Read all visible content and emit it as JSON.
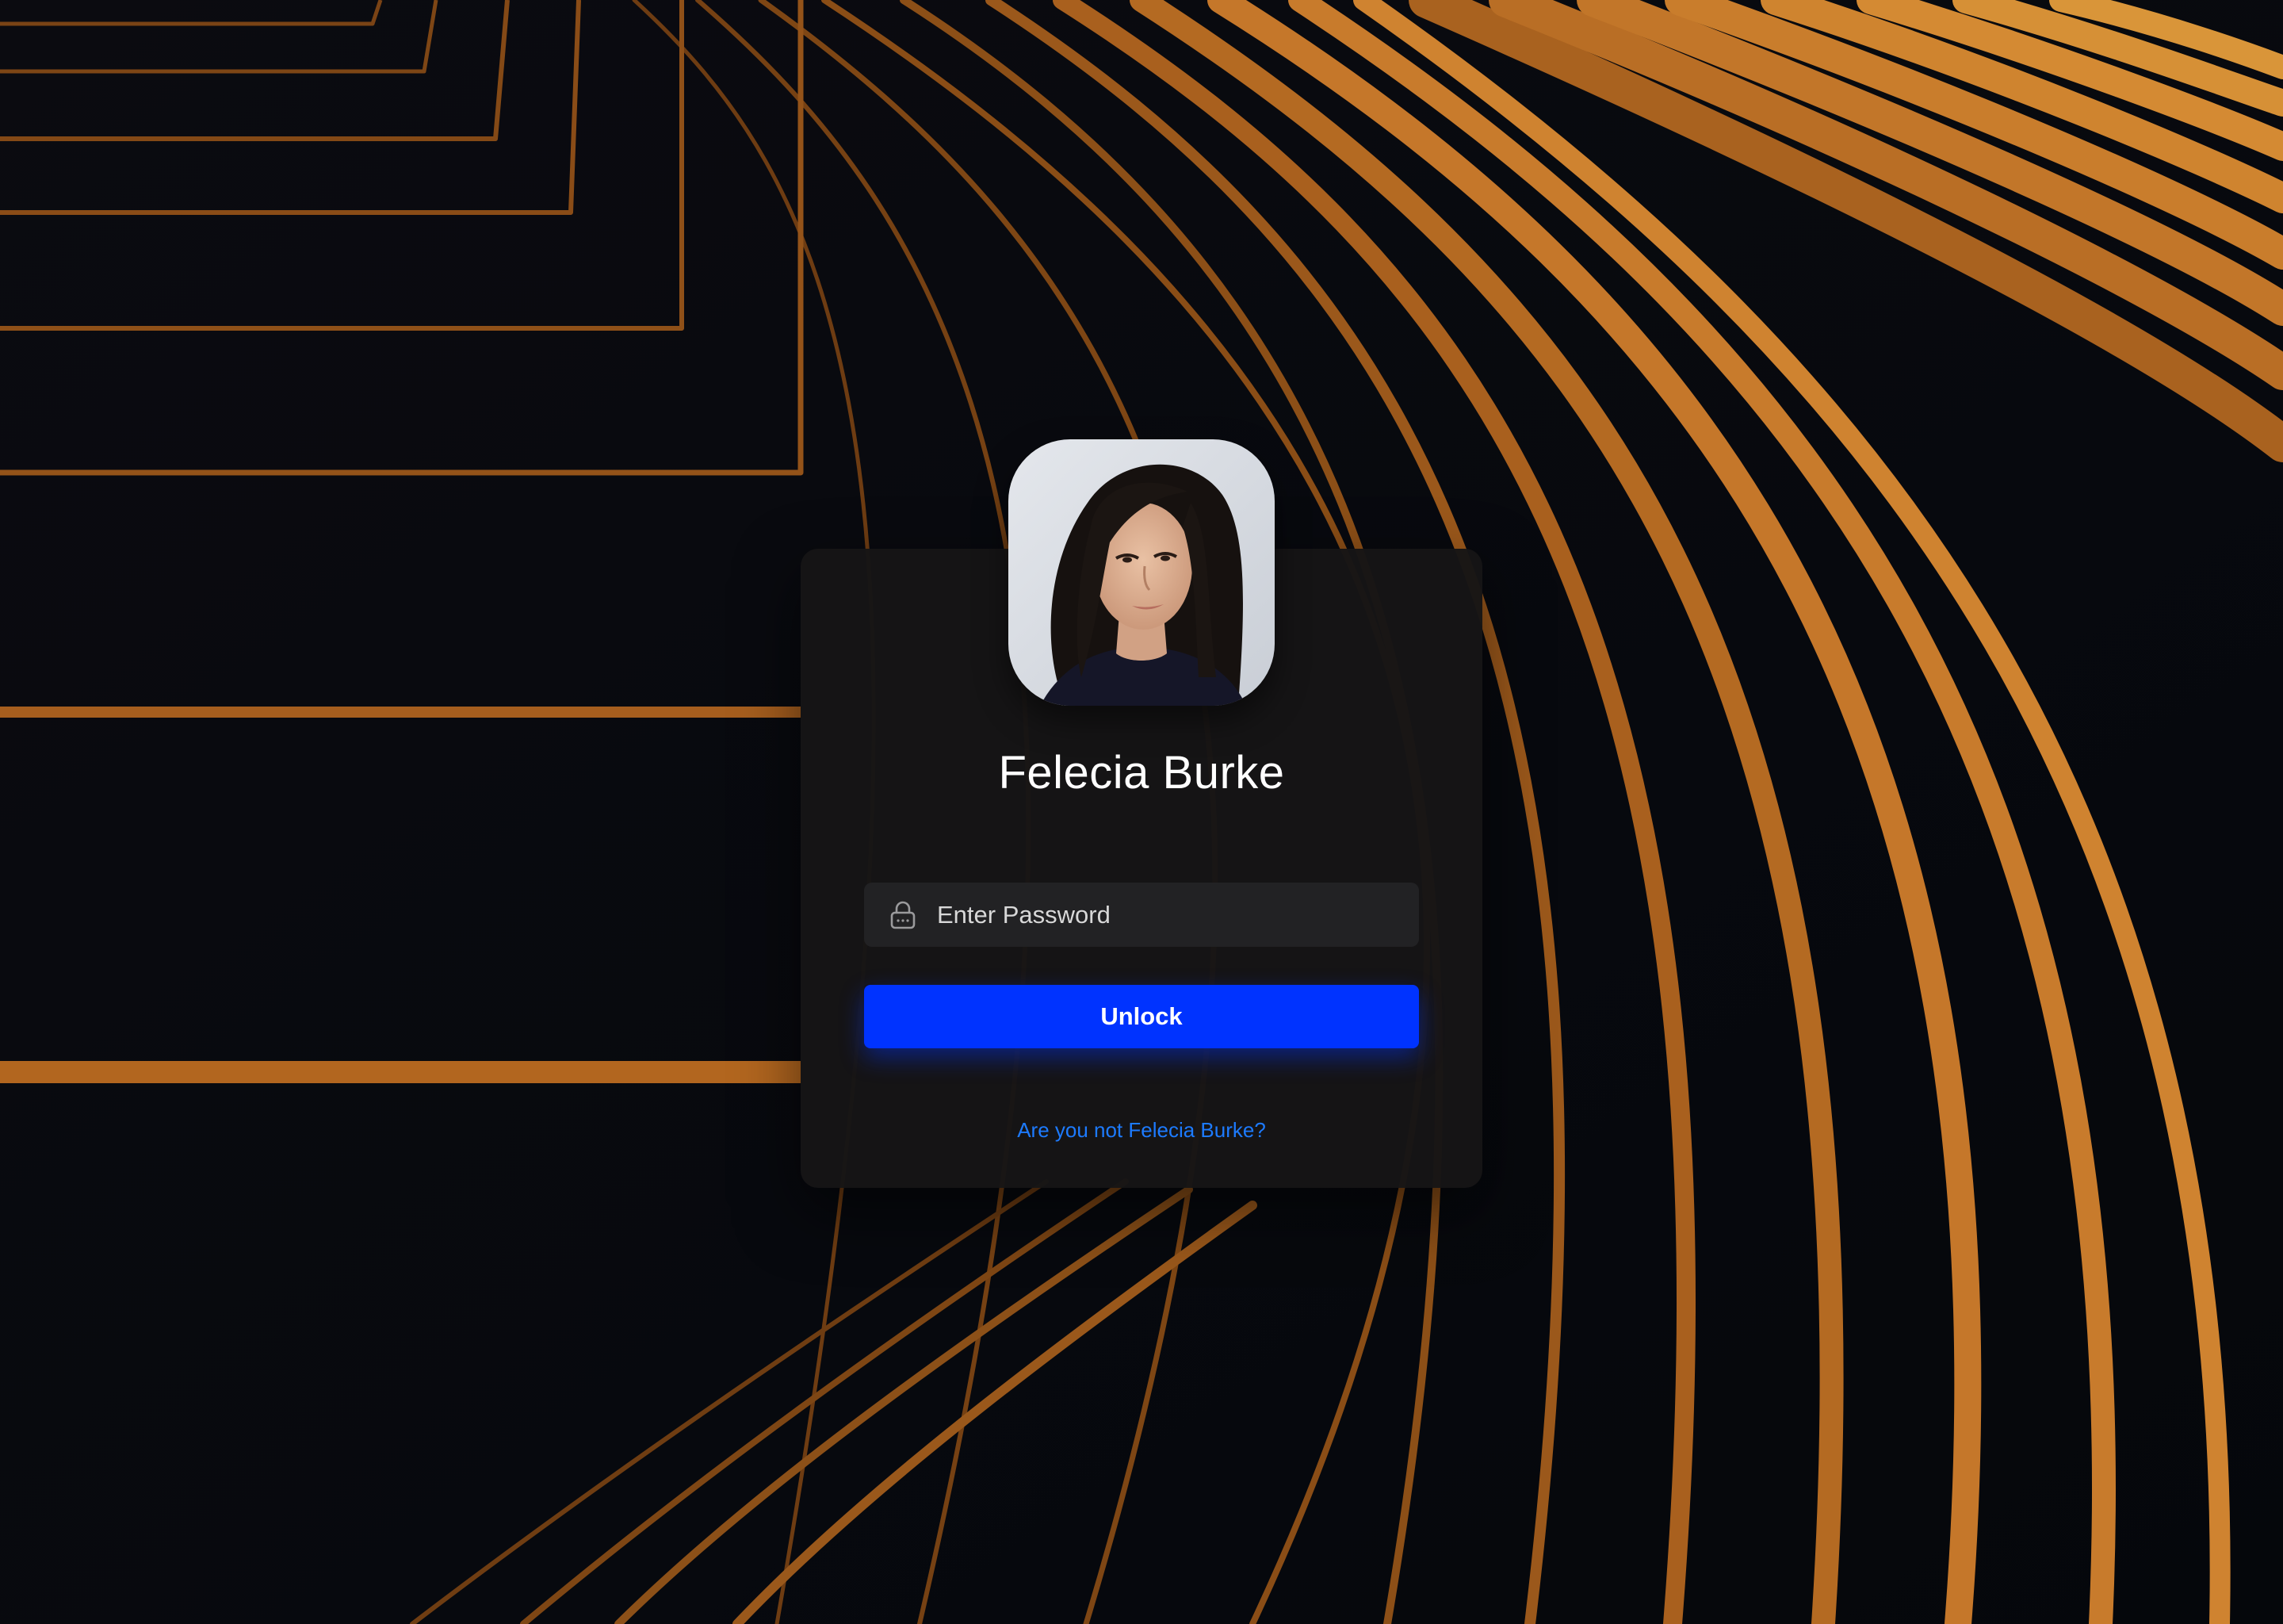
{
  "lock_screen": {
    "user_name": "Felecia Burke",
    "password_placeholder": "Enter Password",
    "unlock_label": "Unlock",
    "switch_user_label": "Are you not Felecia Burke?"
  },
  "icons": {
    "password": "lock-icon"
  },
  "colors": {
    "accent": "#0033ff",
    "link": "#1d7bff",
    "card_background": "#161516",
    "input_background": "#222224",
    "wallpaper_stripe": "#c9761e"
  }
}
